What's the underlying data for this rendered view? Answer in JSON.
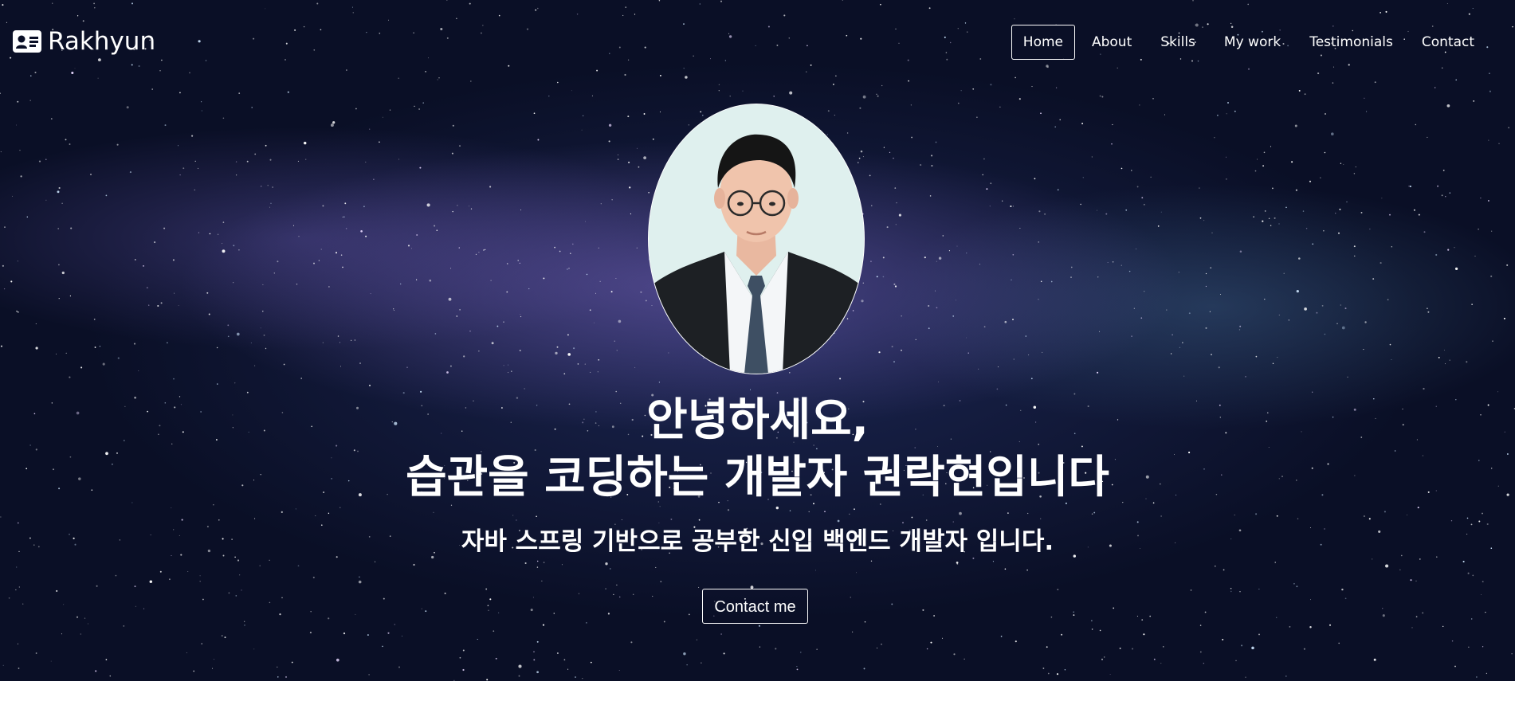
{
  "brand": {
    "name": "Rakhyun",
    "icon": "id-card-icon"
  },
  "nav": {
    "items": [
      {
        "label": "Home",
        "active": true
      },
      {
        "label": "About",
        "active": false
      },
      {
        "label": "Skills",
        "active": false
      },
      {
        "label": "My work",
        "active": false
      },
      {
        "label": "Testimonials",
        "active": false
      },
      {
        "label": "Contact",
        "active": false
      }
    ]
  },
  "hero": {
    "background": "starry-milky-way",
    "greeting": "안녕하세요,",
    "title": "습관을 코딩하는 개발자 권락현입니다",
    "subtitle": "자바 스프링 기반으로 공부한 신입 백엔드 개발자 입니다.",
    "button_label": "Contact me"
  },
  "colors": {
    "text": "#ffffff",
    "bg_dark": "#0a0f26",
    "bg_nebula": "#7864be",
    "suit": "#1d2024",
    "tie": "#3e4f63"
  }
}
